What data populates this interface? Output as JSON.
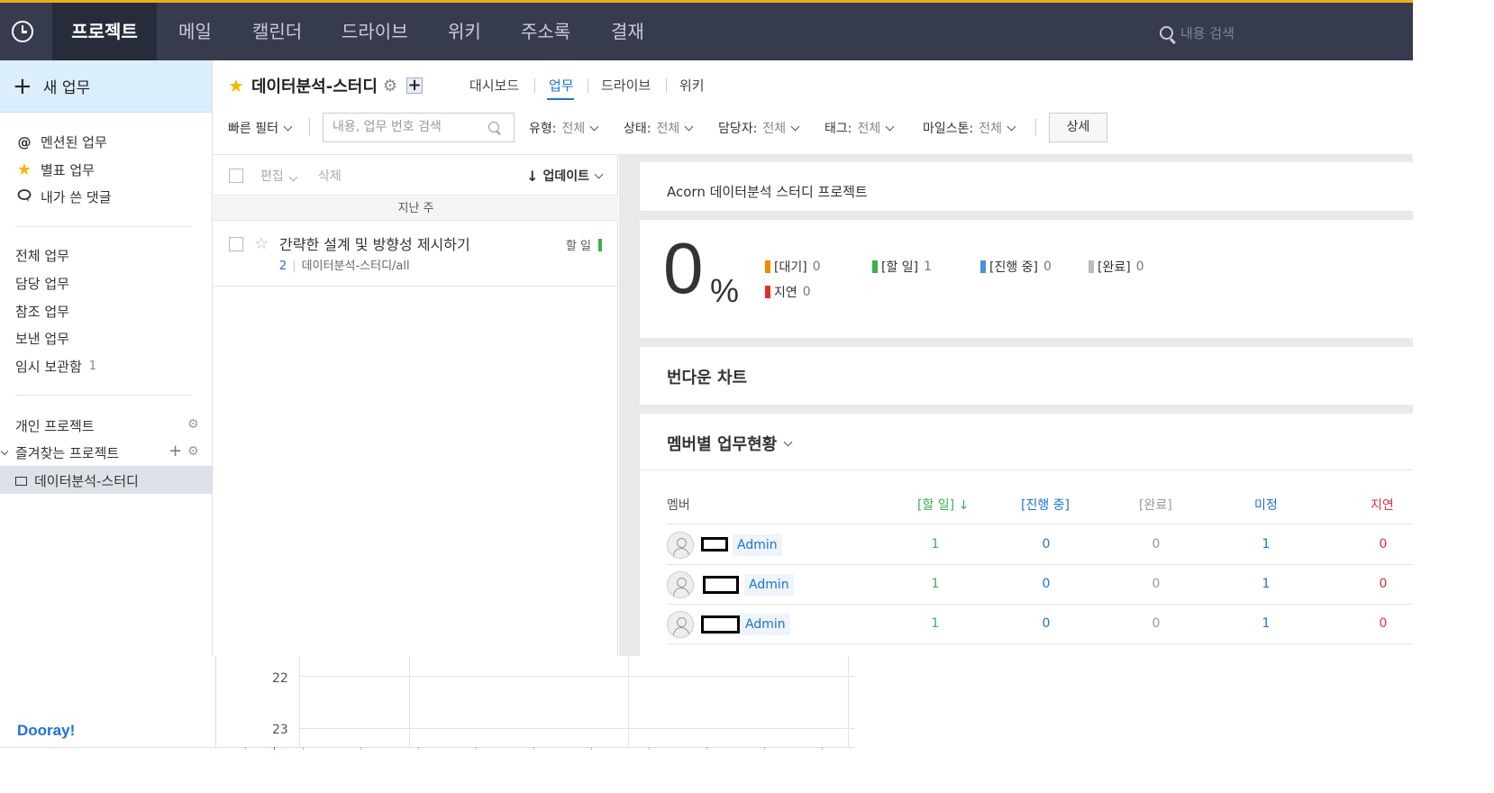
{
  "topnav": {
    "items": [
      {
        "label": "프로젝트",
        "active": true
      },
      {
        "label": "메일"
      },
      {
        "label": "캘린더"
      },
      {
        "label": "드라이브"
      },
      {
        "label": "위키"
      },
      {
        "label": "주소록"
      },
      {
        "label": "결재"
      }
    ],
    "search_placeholder": "내용 검색"
  },
  "sidebar": {
    "new_task": "새 업무",
    "quick": [
      {
        "icon": "at-icon",
        "label": "멘션된 업무"
      },
      {
        "icon": "star-icon",
        "label": "별표 업무"
      },
      {
        "icon": "comment-icon",
        "label": "내가 쓴 댓글"
      }
    ],
    "tasks": [
      {
        "label": "전체 업무"
      },
      {
        "label": "담당 업무"
      },
      {
        "label": "참조 업무"
      },
      {
        "label": "보낸 업무"
      },
      {
        "label": "임시 보관함",
        "count": "1"
      }
    ],
    "personal_project": "개인 프로젝트",
    "favorite_projects": "즐겨찾는 프로젝트",
    "selected_project": "데이터분석-스터디",
    "brand": "Dooray!"
  },
  "project": {
    "name": "데이터분석-스터디",
    "tabs": [
      "대시보드",
      "업무",
      "드라이브",
      "위키"
    ],
    "active_tab": "업무"
  },
  "filters": {
    "quick_filter": "빠른 필터",
    "search_placeholder": "내용, 업무 번호 검색",
    "items": [
      {
        "label": "유형:",
        "value": "전체"
      },
      {
        "label": "상태:",
        "value": "전체"
      },
      {
        "label": "담당자:",
        "value": "전체"
      },
      {
        "label": "태그:",
        "value": "전체"
      },
      {
        "label": "마일스톤:",
        "value": "전체"
      }
    ],
    "detail_button": "상세"
  },
  "tasklist": {
    "edit": "편집",
    "delete": "삭제",
    "sort": "업데이트",
    "week_header": "지난 주",
    "tasks": [
      {
        "title": "간략한 설계 및 방향성 제시하기",
        "number": "2",
        "path": "데이터분석-스터디/all",
        "status": "할 일"
      }
    ]
  },
  "dashboard": {
    "description": "Acorn 데이터분석 스터디 프로젝트",
    "progress": {
      "value": "0",
      "unit": "%"
    },
    "legend": [
      {
        "label": "[대기]",
        "count": "0",
        "color": "#f08c00"
      },
      {
        "label": "[할 일]",
        "count": "1",
        "color": "#37b24d"
      },
      {
        "label": "[진행 중]",
        "count": "0",
        "color": "#4a90e2"
      },
      {
        "label": "[완료]",
        "count": "0",
        "color": "#bbbbbb"
      },
      {
        "label": "지연",
        "count": "0",
        "color": "#e03131"
      }
    ],
    "burndown_title": "번다운 차트",
    "member_title": "멤버별 업무현황",
    "member_columns": {
      "member": "멤버",
      "todo": "[할 일]",
      "in_progress": "[진행 중]",
      "done": "[완료]",
      "unset": "미정",
      "delayed": "지연"
    },
    "colors": {
      "todo": "#37b24d",
      "in_progress": "#1a73d9",
      "done": "#999999",
      "unset": "#1a73d9",
      "delayed": "#e03131"
    },
    "members": [
      {
        "role": "Admin",
        "todo": "1",
        "in_progress": "0",
        "done": "0",
        "unset": "1",
        "delayed": "0"
      },
      {
        "role": "Admin",
        "todo": "1",
        "in_progress": "0",
        "done": "0",
        "unset": "1",
        "delayed": "0"
      },
      {
        "role": "Admin",
        "todo": "1",
        "in_progress": "0",
        "done": "0",
        "unset": "1",
        "delayed": "0"
      }
    ]
  },
  "calendar": {
    "hours": [
      "22",
      "23"
    ]
  }
}
